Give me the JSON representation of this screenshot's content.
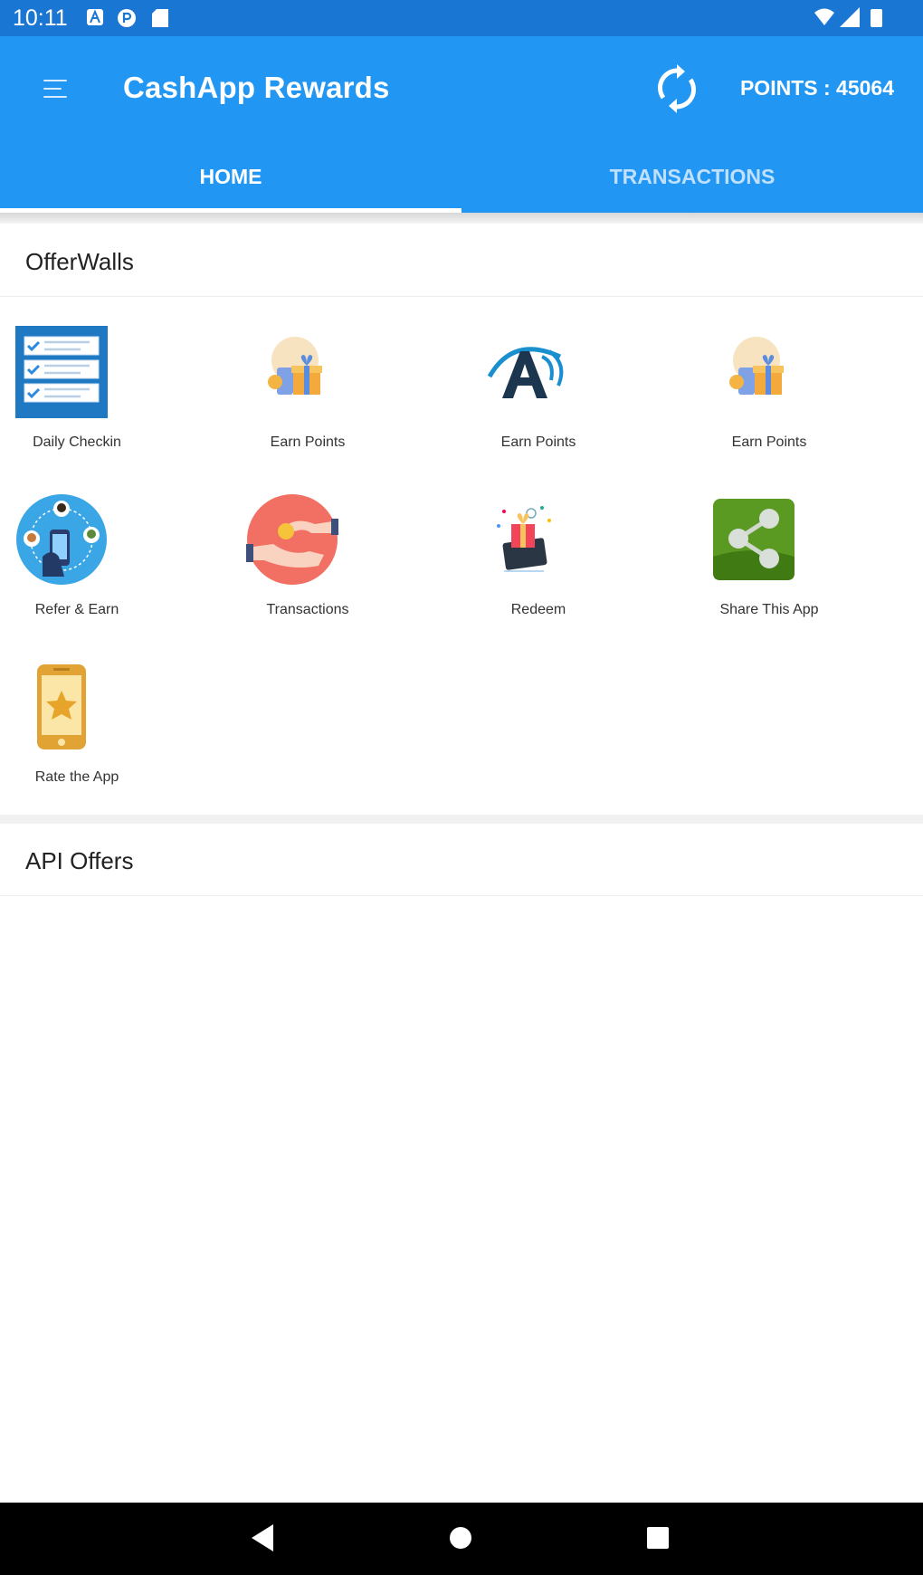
{
  "status_bar": {
    "time": "10:11",
    "left_icons": [
      "a-notification-icon",
      "p-notification-icon",
      "sd-card-icon"
    ],
    "right_icons": [
      "wifi-icon",
      "cell-signal-icon",
      "battery-icon"
    ]
  },
  "app_bar": {
    "title": "CashApp Rewards",
    "points_label": "POINTS : 45064",
    "accent_color": "#2196f3"
  },
  "tabs": [
    {
      "label": "HOME",
      "selected": true
    },
    {
      "label": "TRANSACTIONS",
      "selected": false
    }
  ],
  "offerwalls": {
    "title": "OfferWalls",
    "items": [
      {
        "label": "Daily Checkin",
        "icon": "checklist-icon"
      },
      {
        "label": "Earn Points",
        "icon": "coins-gift-icon"
      },
      {
        "label": "Earn Points",
        "icon": "a-logo-icon"
      },
      {
        "label": "Earn Points",
        "icon": "coins-gift-icon"
      },
      {
        "label": "Refer & Earn",
        "icon": "refer-people-icon"
      },
      {
        "label": "Transactions",
        "icon": "hand-coin-icon"
      },
      {
        "label": "Redeem",
        "icon": "gift-card-icon"
      },
      {
        "label": "Share This App",
        "icon": "share-icon"
      },
      {
        "label": "Rate the App",
        "icon": "phone-star-icon"
      }
    ]
  },
  "api_offers": {
    "title": "API Offers"
  },
  "nav_bar": {
    "buttons": [
      "back-icon",
      "home-icon",
      "recents-icon"
    ]
  }
}
